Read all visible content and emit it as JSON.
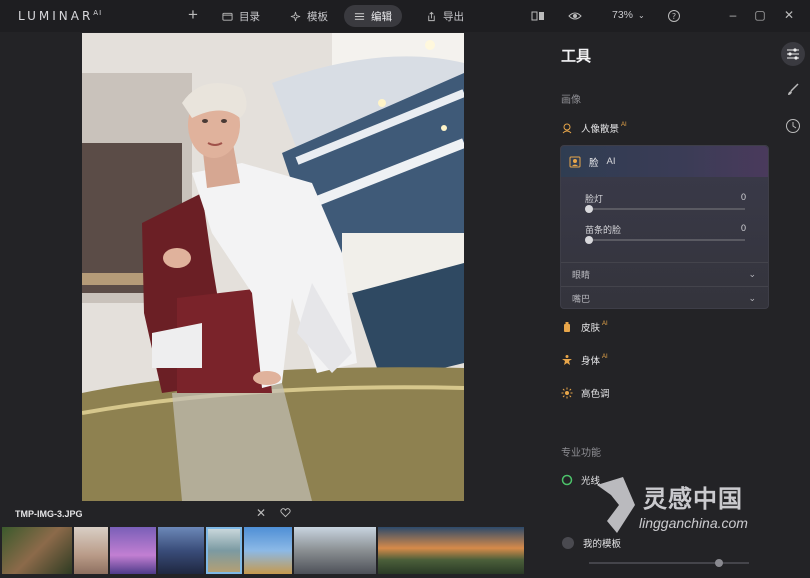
{
  "app": {
    "name": "LUMINAR",
    "version": "AI"
  },
  "nav": {
    "add_label": "+",
    "catalog": "目录",
    "templates": "模板",
    "edit": "编辑",
    "export": "导出"
  },
  "view": {
    "zoom": "73%"
  },
  "filmstrip": {
    "filename": "TMP-IMG-3.JPG",
    "selected_index": 4
  },
  "panel": {
    "title": "工具",
    "section_portrait": "画像",
    "portrait_bokeh": "人像散景",
    "face": {
      "label": "脸",
      "face_light_label": "脸灯",
      "face_light_value": "0",
      "slim_face_label": "苗条的脸",
      "slim_face_value": "0",
      "eyes": "眼睛",
      "mouth": "嘴巴"
    },
    "skin": "皮肤",
    "body": "身体",
    "high_key": "高色调",
    "section_pro": "专业功能",
    "light": "光线",
    "my_templates": "我的模板",
    "ai_badge": "AI"
  },
  "watermark": {
    "line1": "灵感中国",
    "line2": "lingganchina.com"
  },
  "colors": {
    "accent": "#e8a64a",
    "selected_thumb": "#7fb9e6",
    "green": "#4cc26a"
  }
}
